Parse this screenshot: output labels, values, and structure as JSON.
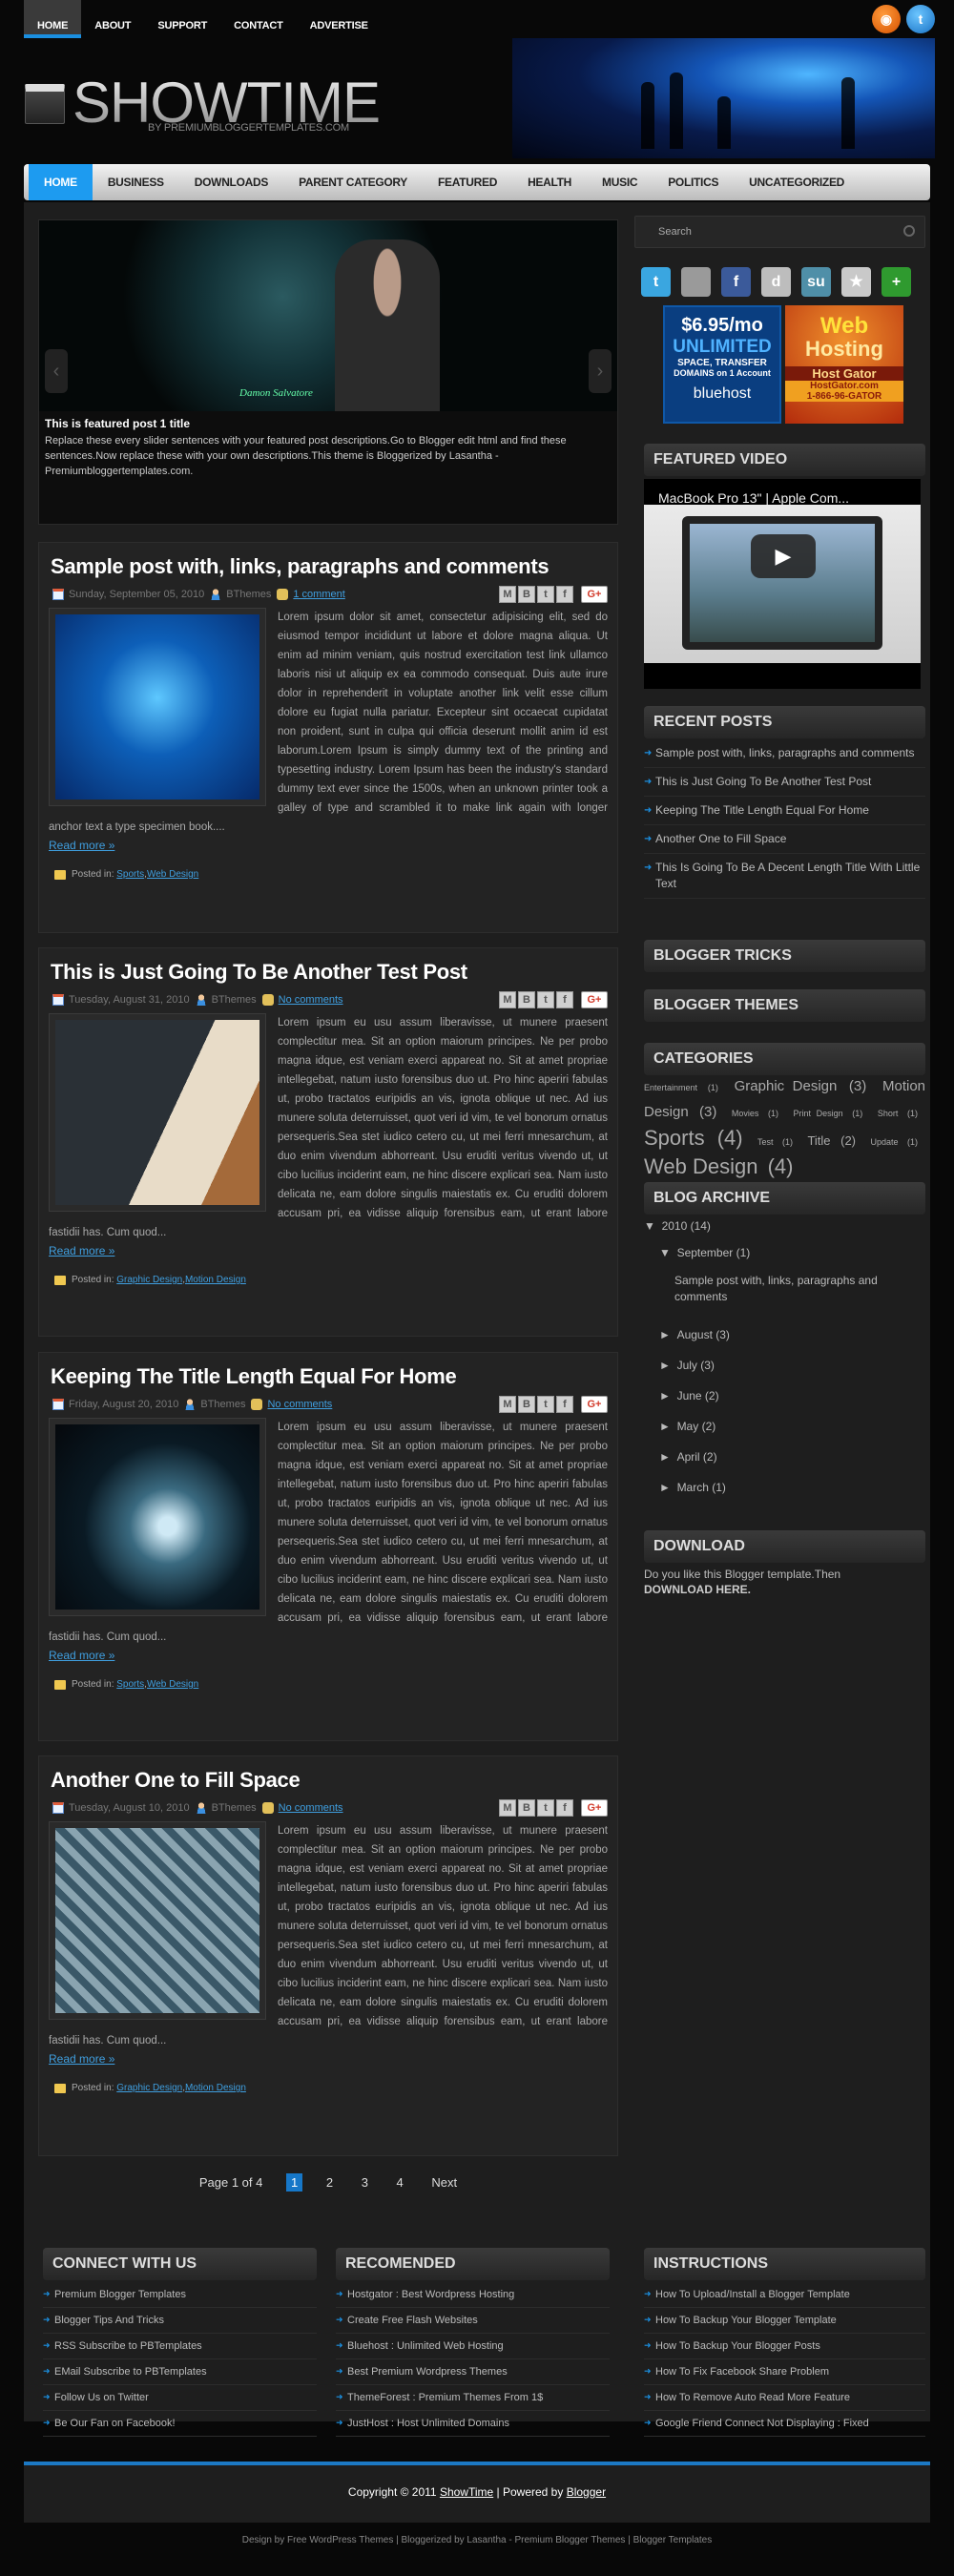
{
  "top_nav": [
    "HOME",
    "ABOUT",
    "SUPPORT",
    "CONTACT",
    "ADVERTISE"
  ],
  "top_social": {
    "rss": "rss-icon",
    "twitter": "twitter-icon"
  },
  "site": {
    "title": "SHOWTIME",
    "subtitle": "BY PREMIUMBLOGGERTEMPLATES.COM"
  },
  "main_nav": [
    "HOME",
    "BUSINESS",
    "DOWNLOADS",
    "PARENT CATEGORY",
    "FEATURED",
    "HEALTH",
    "MUSIC",
    "POLITICS",
    "UNCATEGORIZED"
  ],
  "slider": {
    "title": "This is featured post 1 title",
    "description": "Replace these every slider sentences with your featured post descriptions.Go to Blogger edit html and find these sentences.Now replace these with your own descriptions.This theme is Bloggerized by Lasantha - Premiumbloggertemplates.com.",
    "image_caption": "Damon Salvatore",
    "prev": "‹",
    "next": "›"
  },
  "posts": [
    {
      "title": "Sample post with, links, paragraphs and comments",
      "date": "Sunday, September 05, 2010",
      "author": "BThemes",
      "comments": "1 comment",
      "body": "Lorem ipsum dolor sit amet, consectetur adipisicing elit, sed do eiusmod tempor incididunt ut labore et dolore magna aliqua. Ut enim ad minim veniam, quis nostrud exercitation test link ullamco laboris nisi ut aliquip ex ea commodo consequat. Duis aute irure dolor in reprehenderit in voluptate another link velit esse cillum dolore eu fugiat nulla pariatur. Excepteur sint occaecat cupidatat non proident, sunt in culpa qui officia deserunt mollit anim id est laborum.Lorem Ipsum is simply dummy text of the printing and typesetting industry. Lorem Ipsum has been the industry's standard dummy text ever since the 1500s, when an unknown printer took a galley of type and scrambled it to make link again with longer anchor text a type specimen book....",
      "read_more": "Read more »",
      "posted_in_label": "Posted in:",
      "labels": [
        "Sports",
        "Web Design"
      ]
    },
    {
      "title": "This is Just Going To Be Another Test Post",
      "date": "Tuesday, August 31, 2010",
      "author": "BThemes",
      "comments": "No comments",
      "body": "Lorem ipsum eu usu assum liberavisse, ut munere praesent complectitur mea. Sit an option maiorum principes. Ne per probo magna idque, est veniam exerci appareat no. Sit at amet propriae intellegebat, natum iusto forensibus duo ut. Pro hinc aperiri fabulas ut, probo tractatos euripidis an vis, ignota oblique ut nec. Ad ius munere soluta deterruisset, quot veri id vim, te vel bonorum ornatus persequeris.Sea stet iudico cetero cu, ut mei ferri mnesarchum, at duo enim vivendum abhorreant. Usu eruditi veritus vivendo ut, ut cibo lucilius inciderint eam, ne hinc discere explicari sea. Nam iusto delicata ne, eam dolore singulis maiestatis ex. Cu eruditi dolorem accusam pri, ea vidisse aliquip forensibus eam, ut erant labore fastidii has. Cum quod...",
      "read_more": "Read more »",
      "posted_in_label": "Posted in:",
      "labels": [
        "Graphic Design",
        "Motion Design"
      ]
    },
    {
      "title": "Keeping The Title Length Equal For Home",
      "date": "Friday, August 20, 2010",
      "author": "BThemes",
      "comments": "No comments",
      "body": "Lorem ipsum eu usu assum liberavisse, ut munere praesent complectitur mea. Sit an option maiorum principes. Ne per probo magna idque, est veniam exerci appareat no. Sit at amet propriae intellegebat, natum iusto forensibus duo ut. Pro hinc aperiri fabulas ut, probo tractatos euripidis an vis, ignota oblique ut nec. Ad ius munere soluta deterruisset, quot veri id vim, te vel bonorum ornatus persequeris.Sea stet iudico cetero cu, ut mei ferri mnesarchum, at duo enim vivendum abhorreant. Usu eruditi veritus vivendo ut, ut cibo lucilius inciderint eam, ne hinc discere explicari sea. Nam iusto delicata ne, eam dolore singulis maiestatis ex. Cu eruditi dolorem accusam pri, ea vidisse aliquip forensibus eam, ut erant labore fastidii has. Cum quod...",
      "read_more": "Read more »",
      "posted_in_label": "Posted in:",
      "labels": [
        "Sports",
        "Web Design"
      ]
    },
    {
      "title": "Another One to Fill Space",
      "date": "Tuesday, August 10, 2010",
      "author": "BThemes",
      "comments": "No comments",
      "body": "Lorem ipsum eu usu assum liberavisse, ut munere praesent complectitur mea. Sit an option maiorum principes. Ne per probo magna idque, est veniam exerci appareat no. Sit at amet propriae intellegebat, natum iusto forensibus duo ut. Pro hinc aperiri fabulas ut, probo tractatos euripidis an vis, ignota oblique ut nec. Ad ius munere soluta deterruisset, quot veri id vim, te vel bonorum ornatus persequeris.Sea stet iudico cetero cu, ut mei ferri mnesarchum, at duo enim vivendum abhorreant. Usu eruditi veritus vivendo ut, ut cibo lucilius inciderint eam, ne hinc discere explicari sea. Nam iusto delicata ne, eam dolore singulis maiestatis ex. Cu eruditi dolorem accusam pri, ea vidisse aliquip forensibus eam, ut erant labore fastidii has. Cum quod...",
      "read_more": "Read more »",
      "posted_in_label": "Posted in:",
      "labels": [
        "Graphic Design",
        "Motion Design"
      ]
    }
  ],
  "share_buttons": [
    "M",
    "B",
    "t",
    "f",
    "G+"
  ],
  "pagination": {
    "label": "Page 1 of 4",
    "pages": [
      "1",
      "2",
      "3",
      "4"
    ],
    "current": "1",
    "next": "Next"
  },
  "sidebar": {
    "search_placeholder": "Search",
    "social_icons": [
      {
        "name": "twitter-icon",
        "glyph": "t",
        "color": "#3aa6e0"
      },
      {
        "name": "delicious-icon",
        "glyph": "",
        "color": "#9a9a9a"
      },
      {
        "name": "facebook-icon",
        "glyph": "f",
        "color": "#3b5a9a"
      },
      {
        "name": "digg-icon",
        "glyph": "d",
        "color": "#bdbdbd"
      },
      {
        "name": "stumbleupon-icon",
        "glyph": "su",
        "color": "#4f8fa8"
      },
      {
        "name": "favorites-icon",
        "glyph": "★",
        "color": "#c9c9c9"
      },
      {
        "name": "add-icon",
        "glyph": "+",
        "color": "#2f9a2f"
      }
    ],
    "ads": {
      "bluehost": {
        "price": "$6.95/mo",
        "line1": "UNLIMITED",
        "line2": "SPACE, TRANSFER",
        "line3": "DOMAINS on 1 Account",
        "brand": "bluehost"
      },
      "hostgator": {
        "line1": "Web",
        "line2": "Hosting",
        "brand": "Host Gator",
        "site": "HostGator.com",
        "phone": "1-866-96-GATOR"
      }
    },
    "featured_video": {
      "title": "FEATURED VIDEO",
      "video_title": "MacBook Pro 13\" | Apple Com..."
    },
    "recent_posts": {
      "title": "RECENT POSTS",
      "items": [
        "Sample post with, links, paragraphs and comments",
        "This is Just Going To Be Another Test Post",
        "Keeping The Title Length Equal For Home",
        "Another One to Fill Space",
        "This Is Going To Be A Decent Length Title With Little Text"
      ]
    },
    "blogger_tricks": "BLOGGER TRICKS",
    "blogger_themes": "BLOGGER THEMES",
    "categories": {
      "title": "CATEGORIES",
      "items": [
        {
          "name": "Entertainment",
          "count": "(1)",
          "size": "s"
        },
        {
          "name": "Graphic Design",
          "count": "(3)",
          "size": "l"
        },
        {
          "name": "Motion Design",
          "count": "(3)",
          "size": "l"
        },
        {
          "name": "Movies",
          "count": "(1)",
          "size": "s"
        },
        {
          "name": "Print Design",
          "count": "(1)",
          "size": "s"
        },
        {
          "name": "Short",
          "count": "(1)",
          "size": "s"
        },
        {
          "name": "Sports",
          "count": "(4)",
          "size": "xl"
        },
        {
          "name": "Test",
          "count": "(1)",
          "size": "s"
        },
        {
          "name": "Title",
          "count": "(2)",
          "size": "m"
        },
        {
          "name": "Update",
          "count": "(1)",
          "size": "s"
        },
        {
          "name": "Web Design",
          "count": "(4)",
          "size": "xl"
        }
      ]
    },
    "archive": {
      "title": "BLOG ARCHIVE",
      "year": "2010 (14)",
      "open_month": "September (1)",
      "open_month_post": "Sample post with, links, paragraphs and comments",
      "months": [
        "August (3)",
        "July (3)",
        "June (2)",
        "May (2)",
        "April (2)",
        "March (1)"
      ]
    },
    "download": {
      "title": "DOWNLOAD",
      "text": "Do you like this Blogger template.Then",
      "link": "DOWNLOAD HERE."
    }
  },
  "footer": {
    "columns": [
      {
        "title": "CONNECT WITH US",
        "items": [
          "Premium Blogger Templates",
          "Blogger Tips And Tricks",
          "RSS Subscribe to PBTemplates",
          "EMail Subscribe to PBTemplates",
          "Follow Us on Twitter",
          "Be Our Fan on Facebook!"
        ]
      },
      {
        "title": "RECOMENDED",
        "items": [
          "Hostgator : Best Wordpress Hosting",
          "Create Free Flash Websites",
          "Bluehost : Unlimited Web Hosting",
          "Best Premium Wordpress Themes",
          "ThemeForest : Premium Themes From 1$",
          "JustHost : Host Unlimited Domains"
        ]
      },
      {
        "title": "INSTRUCTIONS",
        "items": [
          "How To Upload/Install a Blogger Template",
          "How To Backup Your Blogger Template",
          "How To Backup Your Blogger Posts",
          "How To Fix Facebook Share Problem",
          "How To Remove Auto Read More Feature",
          "Google Friend Connect Not Displaying : Fixed"
        ]
      }
    ],
    "copyright_prefix": "Copyright © 2011",
    "site_link": "ShowTime",
    "powered_by": "| Powered by",
    "blogger_link": "Blogger",
    "credits": "Design by Free WordPress Themes | Bloggerized by Lasantha - Premium Blogger Themes | Blogger Templates"
  }
}
